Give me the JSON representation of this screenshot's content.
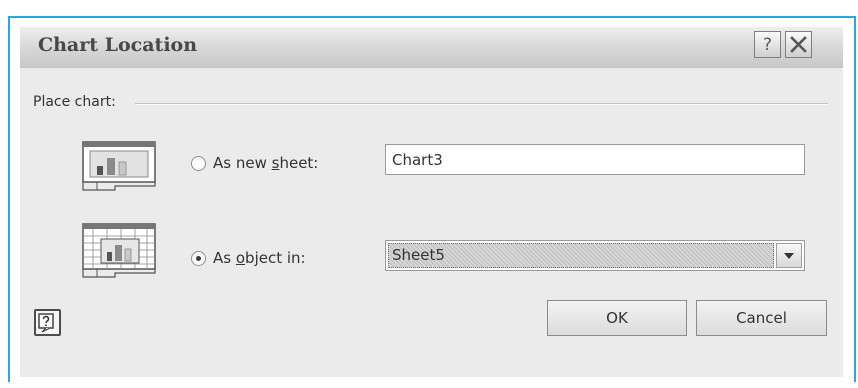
{
  "dialog": {
    "title": "Chart Location",
    "help_glyph": "?",
    "group_label": "Place chart:",
    "options": [
      {
        "label_pre": "As new ",
        "label_key": "s",
        "label_post": "heet:",
        "selected": false,
        "value": "Chart3",
        "icon": "chart-sheet-icon"
      },
      {
        "label_pre": "As ",
        "label_key": "o",
        "label_post": "bject in:",
        "selected": true,
        "value": "Sheet5",
        "icon": "embedded-chart-icon"
      }
    ],
    "ok_label": "OK",
    "cancel_label": "Cancel",
    "context_help_icon": "context-help-icon"
  },
  "colors": {
    "frame_border": "#29a8e0",
    "dialog_bg": "#ebebeb"
  }
}
